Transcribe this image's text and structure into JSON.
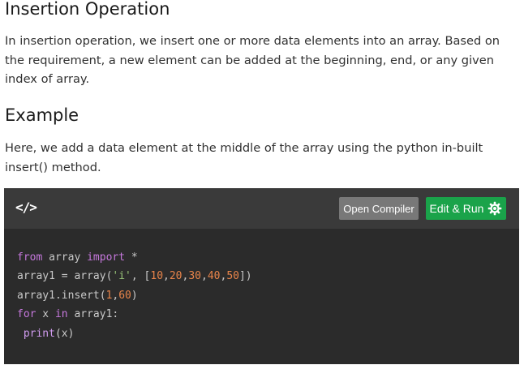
{
  "section": {
    "title": "Insertion Operation",
    "paragraph": "In insertion operation, we insert one or more data elements into an array. Based on the requirement, a new element can be added at the beginning, end, or any given index of array."
  },
  "example": {
    "title": "Example",
    "paragraph": "Here, we add a data element at the middle of the array using the python in-built insert() method."
  },
  "code_block": {
    "icon_label": "</>",
    "icon_name": "code-icon",
    "open_compiler_label": "Open Compiler",
    "edit_run_label": "Edit & Run",
    "run_icon_name": "gear-icon",
    "lines": [
      [
        {
          "t": "from",
          "c": "kw"
        },
        {
          "t": " array ",
          "c": "plain"
        },
        {
          "t": "import",
          "c": "kw"
        },
        {
          "t": " *",
          "c": "plain"
        }
      ],
      [
        {
          "t": "array1 = array(",
          "c": "plain"
        },
        {
          "t": "'i'",
          "c": "str"
        },
        {
          "t": ", [",
          "c": "plain"
        },
        {
          "t": "10",
          "c": "num"
        },
        {
          "t": ",",
          "c": "plain"
        },
        {
          "t": "20",
          "c": "num"
        },
        {
          "t": ",",
          "c": "plain"
        },
        {
          "t": "30",
          "c": "num"
        },
        {
          "t": ",",
          "c": "plain"
        },
        {
          "t": "40",
          "c": "num"
        },
        {
          "t": ",",
          "c": "plain"
        },
        {
          "t": "50",
          "c": "num"
        },
        {
          "t": "])",
          "c": "plain"
        }
      ],
      [
        {
          "t": "array1.insert(",
          "c": "plain"
        },
        {
          "t": "1",
          "c": "num"
        },
        {
          "t": ",",
          "c": "plain"
        },
        {
          "t": "60",
          "c": "num"
        },
        {
          "t": ")",
          "c": "plain"
        }
      ],
      [
        {
          "t": "for",
          "c": "kw"
        },
        {
          "t": " x ",
          "c": "plain"
        },
        {
          "t": "in",
          "c": "kw"
        },
        {
          "t": " array1:",
          "c": "plain"
        }
      ],
      [
        {
          "t": " ",
          "c": "plain"
        },
        {
          "t": "print",
          "c": "kw2"
        },
        {
          "t": "(x)",
          "c": "plain"
        }
      ]
    ]
  },
  "colors": {
    "code_bg": "#2b2b2b",
    "code_header_bg": "#3a3a3a",
    "open_compiler_bg": "#787878",
    "edit_run_bg": "#1aa34a"
  }
}
